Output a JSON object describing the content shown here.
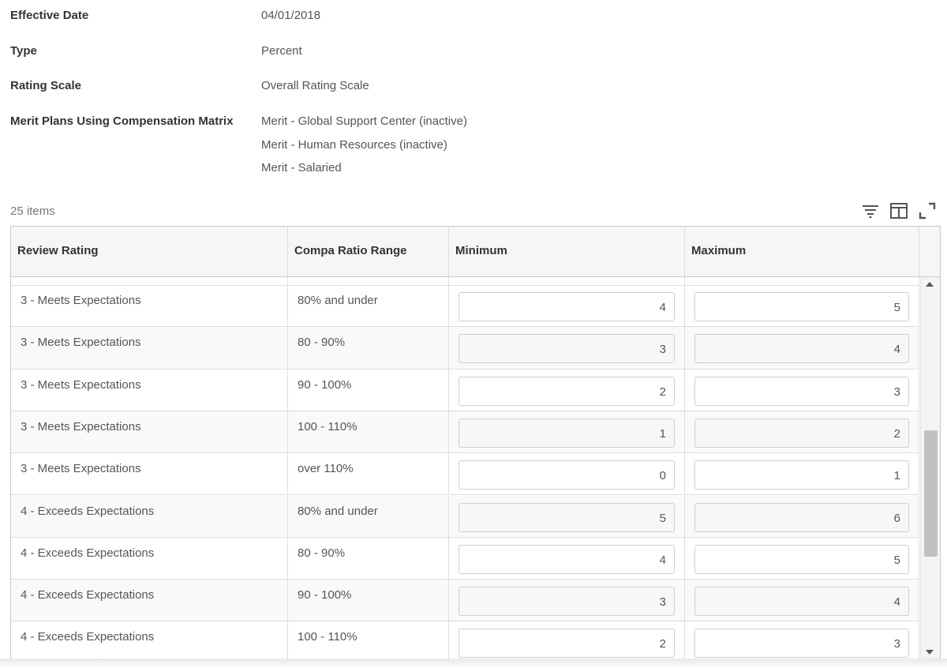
{
  "details": {
    "effective_date": {
      "label": "Effective Date",
      "value": "04/01/2018"
    },
    "type": {
      "label": "Type",
      "value": "Percent"
    },
    "rating_scale": {
      "label": "Rating Scale",
      "value": "Overall Rating Scale"
    },
    "merit_plans": {
      "label": "Merit Plans Using Compensation Matrix",
      "values": [
        "Merit - Global Support Center (inactive)",
        "Merit - Human Resources (inactive)",
        "Merit - Salaried"
      ]
    }
  },
  "grid": {
    "items_count": "25 items",
    "toolbar": {
      "filter": "filter-icon",
      "columns": "columns-icon",
      "expand": "expand-icon"
    },
    "columns": [
      "Review Rating",
      "Compa Ratio Range",
      "Minimum",
      "Maximum"
    ],
    "rows": [
      {
        "rating": "3 - Meets Expectations",
        "range": "80% and under",
        "min": "4",
        "max": "5"
      },
      {
        "rating": "3 - Meets Expectations",
        "range": "80 - 90%",
        "min": "3",
        "max": "4"
      },
      {
        "rating": "3 - Meets Expectations",
        "range": "90 - 100%",
        "min": "2",
        "max": "3"
      },
      {
        "rating": "3 - Meets Expectations",
        "range": "100 - 110%",
        "min": "1",
        "max": "2"
      },
      {
        "rating": "3 - Meets Expectations",
        "range": "over 110%",
        "min": "0",
        "max": "1"
      },
      {
        "rating": "4 - Exceeds Expectations",
        "range": "80% and under",
        "min": "5",
        "max": "6"
      },
      {
        "rating": "4 - Exceeds Expectations",
        "range": "80 - 90%",
        "min": "4",
        "max": "5"
      },
      {
        "rating": "4 - Exceeds Expectations",
        "range": "90 - 100%",
        "min": "3",
        "max": "4"
      },
      {
        "rating": "4 - Exceeds Expectations",
        "range": "100 - 110%",
        "min": "2",
        "max": "3"
      }
    ]
  }
}
